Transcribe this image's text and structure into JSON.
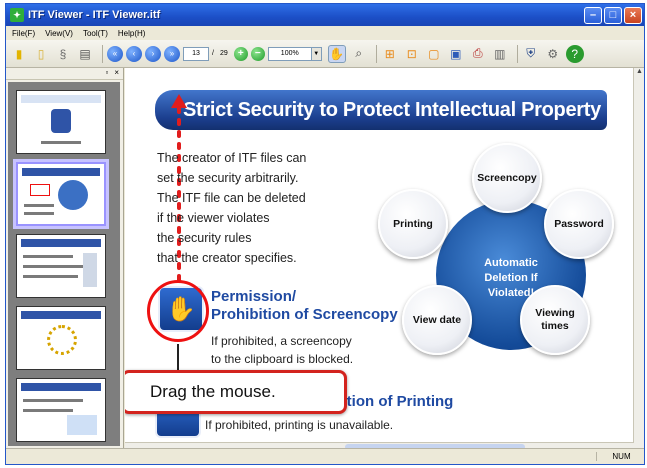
{
  "window": {
    "title": "ITF Viewer - ITF Viewer.itf"
  },
  "menu": {
    "items": [
      "File(F)",
      "View(V)",
      "Tool(T)",
      "Help(H)"
    ]
  },
  "toolbar": {
    "page_current": "13",
    "page_sep": "/",
    "page_total": "29",
    "zoom": "100%"
  },
  "slide": {
    "title": "Strict Security to Protect Intellectual Property",
    "intro_lines": [
      "The creator of ITF files can",
      "set the security arbitrarily.",
      "The ITF file can be deleted",
      "if the viewer violates",
      "the security rules",
      "that the creator specifies."
    ],
    "center_label": [
      "Automatic",
      "Deletion If",
      "Violated!"
    ],
    "nodes": {
      "screencopy": "Screencopy",
      "password": "Password",
      "printing": "Printing",
      "view_date": "View date",
      "viewing_times_1": "Viewing",
      "viewing_times_2": "times"
    },
    "permission_title_1": "Permission/",
    "permission_title_2": "Prohibition of Screencopy",
    "permission_body_1": "If prohibited, a screencopy",
    "permission_body_2": "to the clipboard is blocked.",
    "printing_title": "Prohibition of Printing",
    "printing_body": "If prohibited, printing is unavailable."
  },
  "callout": {
    "text": "Drag the mouse."
  },
  "status": {
    "num": "NUM"
  },
  "colors": {
    "title_blue": "#1c4fc7",
    "accent_red": "#e11d1d",
    "banner": "#1c3f8f"
  }
}
